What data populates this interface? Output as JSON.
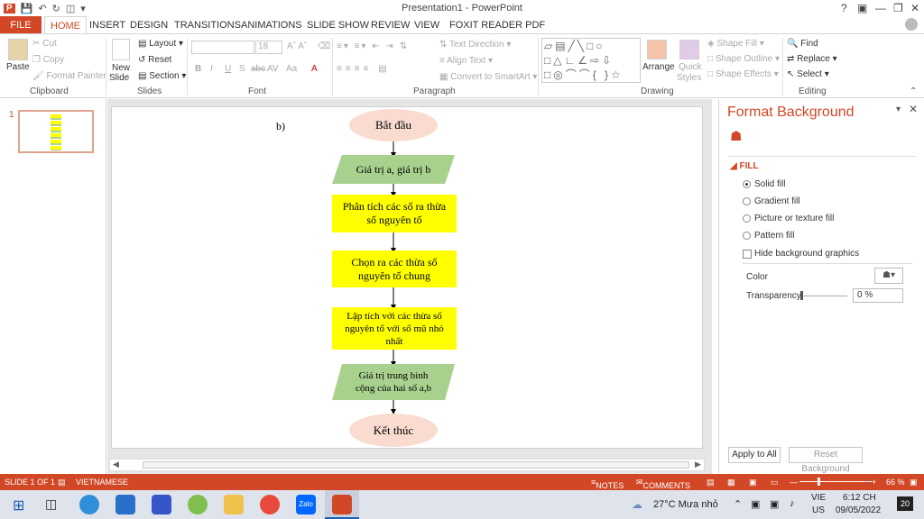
{
  "window": {
    "title": "Presentation1 - PowerPoint",
    "app_badge": "P",
    "help": "?"
  },
  "tabs": [
    "FILE",
    "HOME",
    "INSERT",
    "DESIGN",
    "TRANSITIONS",
    "ANIMATIONS",
    "SLIDE SHOW",
    "REVIEW",
    "VIEW",
    "FOXIT READER PDF"
  ],
  "ribbon": {
    "clipboard": {
      "paste": "Paste",
      "cut": "Cut",
      "copy": "Copy",
      "format_painter": "Format Painter",
      "label": "Clipboard"
    },
    "slides": {
      "new_slide": "New",
      "new_slide2": "Slide",
      "layout": "Layout",
      "reset": "Reset",
      "section": "Section",
      "label": "Slides"
    },
    "font": {
      "size": "18",
      "label": "Font",
      "bold": "B",
      "italic": "I",
      "underline": "U",
      "strike": "S",
      "abc": "abc",
      "av": "AV",
      "aa": "Aa"
    },
    "paragraph": {
      "text_direction": "Text Direction",
      "align_text": "Align Text",
      "smartart": "Convert to SmartArt",
      "label": "Paragraph"
    },
    "drawing": {
      "arrange": "Arrange",
      "quick_styles": "Quick",
      "quick_styles2": "Styles",
      "shape_fill": "Shape Fill",
      "shape_outline": "Shape Outline",
      "shape_effects": "Shape Effects",
      "label": "Drawing"
    },
    "editing": {
      "find": "Find",
      "replace": "Replace",
      "select": "Select",
      "label": "Editing"
    }
  },
  "thumbnail": {
    "number": "1"
  },
  "slide": {
    "label_b": "b)",
    "shapes": [
      {
        "text": "Bắt đầu",
        "kind": "oval"
      },
      {
        "text": "Giá trị a, giá trị b",
        "kind": "parallelogram"
      },
      {
        "text": "Phân tích các số ra thừa số nguyên tố",
        "kind": "rect"
      },
      {
        "text": "Chọn ra các thừa số nguyên tố chung",
        "kind": "rect"
      },
      {
        "text": "Lập tích với các thừa số nguyên tố với số mũ nhỏ nhất",
        "kind": "rect"
      },
      {
        "text": "Giá trị trung bình cộng của hai số a,b",
        "kind": "parallelogram"
      },
      {
        "text": "Kết thúc",
        "kind": "oval"
      }
    ],
    "colors": {
      "oval": "#f9dccf",
      "parallelogram": "#a9d18e",
      "rect": "#ffff00"
    }
  },
  "format_background": {
    "title": "Format Background",
    "section": "FILL",
    "options": [
      "Solid fill",
      "Gradient fill",
      "Picture or texture fill",
      "Pattern fill"
    ],
    "selected_option": "Solid fill",
    "hide_bg": "Hide background graphics",
    "color_label": "Color",
    "transparency_label": "Transparency",
    "transparency_value": "0 %",
    "apply_all": "Apply to All",
    "reset_bg": "Reset Background"
  },
  "status": {
    "slide": "SLIDE 1 OF 1",
    "language": "VIETNAMESE",
    "notes": "NOTES",
    "comments": "COMMENTS",
    "zoom": "66 %"
  },
  "taskbar": {
    "weather": "27°C  Mưa nhỏ",
    "lang1": "VIE",
    "lang2": "US",
    "time": "6:12 CH",
    "date": "09/05/2022",
    "notif": "20",
    "zalo": "Zalo"
  },
  "accent": "#d24726"
}
